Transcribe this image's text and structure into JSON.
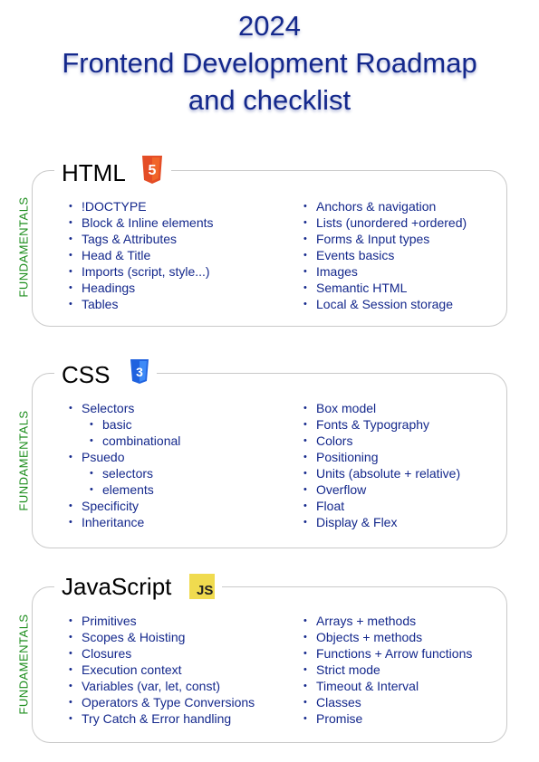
{
  "title": {
    "line1": "2024",
    "line2": "Frontend Development Roadmap",
    "line3": "and checklist"
  },
  "side_label": "FUNDAMENTALS",
  "html": {
    "heading": "HTML",
    "icon_number": "5",
    "left": [
      "!DOCTYPE",
      "Block & Inline elements",
      "Tags & Attributes",
      "Head & Title",
      "Imports (script, style...)",
      "Headings",
      "Tables"
    ],
    "right": [
      "Anchors & navigation",
      "Lists (unordered +ordered)",
      "Forms & Input types",
      "Events basics",
      "Images",
      "Semantic HTML",
      "Local & Session storage"
    ]
  },
  "css": {
    "heading": "CSS",
    "icon_number": "3",
    "left": [
      "Selectors",
      "basic",
      "combinational",
      "Psuedo",
      "selectors",
      "elements",
      "Specificity",
      "Inheritance"
    ],
    "right": [
      "Box model",
      "Fonts & Typography",
      "Colors",
      "Positioning",
      "Units (absolute + relative)",
      "Overflow",
      "Float",
      "Display & Flex"
    ]
  },
  "js": {
    "heading": "JavaScript",
    "badge": "JS",
    "left": [
      "Primitives",
      "Scopes & Hoisting",
      "Closures",
      "Execution context",
      "Variables (var, let, const)",
      "Operators & Type Conversions",
      "Try Catch & Error handling"
    ],
    "right": [
      "Arrays + methods",
      "Objects + methods",
      "Functions + Arrow functions",
      "Strict mode",
      "Timeout & Interval",
      "Classes",
      "Promise"
    ]
  },
  "colors": {
    "title": "#14288c",
    "fundamentals": "#1a8c1a",
    "html5": "#e44d26",
    "css3": "#1f62df",
    "js": "#f0db4f"
  }
}
